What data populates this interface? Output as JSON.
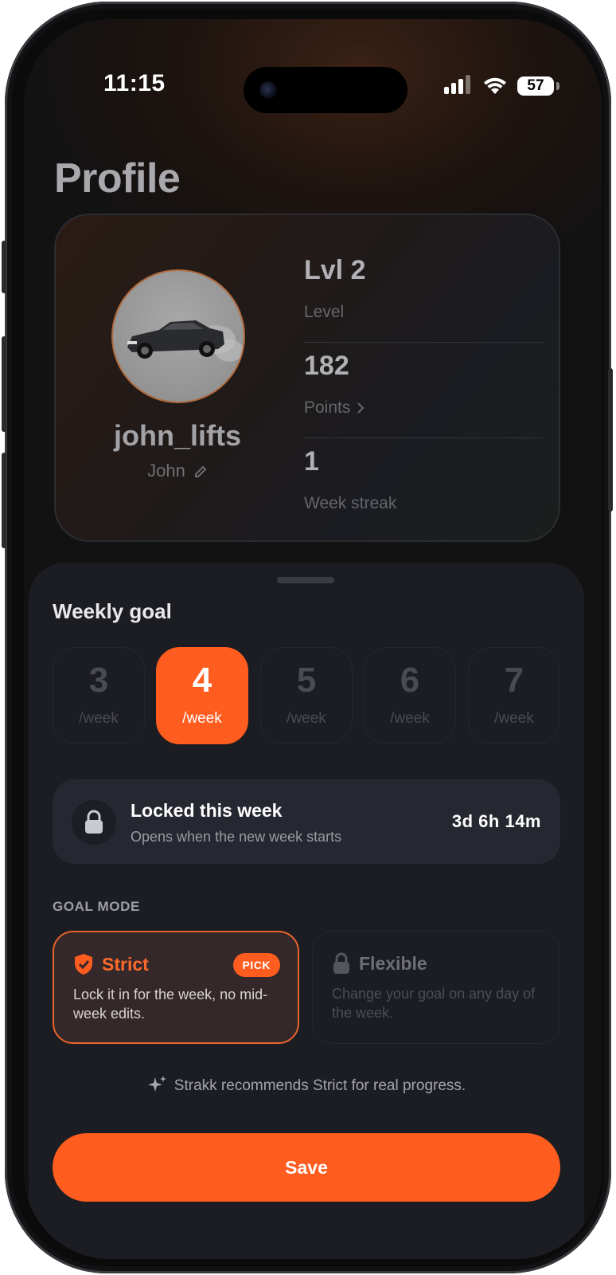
{
  "status_bar": {
    "time": "11:15",
    "battery": "57"
  },
  "page": {
    "title": "Profile"
  },
  "profile": {
    "username": "john_lifts",
    "display_name": "John",
    "stats": [
      {
        "value": "Lvl 2",
        "label": "Level"
      },
      {
        "value": "182",
        "label": "Points"
      },
      {
        "value": "1",
        "label": "Week streak"
      }
    ]
  },
  "weekly_goal": {
    "title": "Weekly goal",
    "unit": "/week",
    "options": [
      "3",
      "4",
      "5",
      "6",
      "7"
    ],
    "selected": "4"
  },
  "lock_notice": {
    "title": "Locked this week",
    "subtitle": "Opens when the new week starts",
    "countdown": "3d 6h 14m"
  },
  "goal_mode": {
    "label": "GOAL MODE",
    "strict": {
      "name": "Strict",
      "badge": "PICK",
      "description": "Lock it in for the week, no mid-week edits."
    },
    "flexible": {
      "name": "Flexible",
      "description": "Change your goal on any day of the week."
    }
  },
  "recommendation": "Strakk recommends Strict for real progress.",
  "save_label": "Save",
  "colors": {
    "accent": "#ff5c1f",
    "sheet": "#1c1d22",
    "background": "#121213"
  }
}
